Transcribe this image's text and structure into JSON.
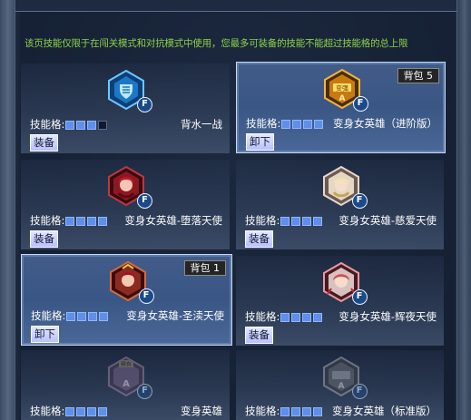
{
  "notice": "该页技能仅限于在闯关模式和对抗模式中使用，您最多可装备的技能不能超过技能格的总上限",
  "slot_label": "技能格:",
  "f_label": "F",
  "cards": [
    {
      "name": "背水一战",
      "slots_filled": 3,
      "slots_total": 4,
      "button": "装备",
      "selected": false,
      "icon": "shield-icon",
      "icon_text": ""
    },
    {
      "name": "变身女英雄（进阶版）",
      "slots_filled": 4,
      "slots_total": 4,
      "button": "卸下",
      "selected": true,
      "bag": "背包 5",
      "icon": "hero-advanced-icon",
      "icon_text": "变强"
    },
    {
      "name": "变身女英雄-堕落天使",
      "slots_filled": 4,
      "slots_total": 4,
      "button": "装备",
      "selected": false,
      "icon": "fallen-angel-portrait-icon",
      "icon_text": ""
    },
    {
      "name": "变身女英雄-慈爱天使",
      "slots_filled": 4,
      "slots_total": 4,
      "button": "装备",
      "selected": false,
      "icon": "loving-angel-portrait-icon",
      "icon_text": ""
    },
    {
      "name": "变身女英雄-圣渎天使",
      "slots_filled": 4,
      "slots_total": 4,
      "button": "卸下",
      "selected": true,
      "bag": "背包 1",
      "icon": "holy-angel-portrait-icon",
      "icon_text": ""
    },
    {
      "name": "变身女英雄-辉夜天使",
      "slots_filled": 4,
      "slots_total": 4,
      "button": "装备",
      "selected": false,
      "icon": "night-angel-portrait-icon",
      "icon_text": ""
    },
    {
      "name": "变身英雄",
      "slots_filled": 4,
      "slots_total": 4,
      "button": "",
      "selected": false,
      "icon": "hero-basic-icon",
      "icon_text": "稀有"
    },
    {
      "name": "变身女英雄（标准版）",
      "slots_filled": 4,
      "slots_total": 4,
      "button": "",
      "selected": false,
      "icon": "hero-standard-icon",
      "icon_text": ""
    }
  ]
}
